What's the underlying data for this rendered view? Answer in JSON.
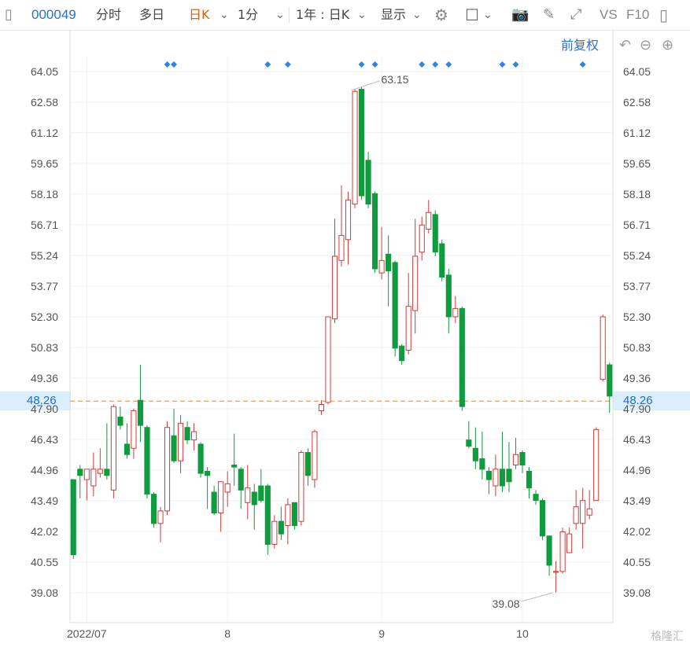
{
  "toolbar": {
    "code": "000049",
    "tabs": [
      "分时",
      "多日",
      "日K"
    ],
    "period": "1分",
    "range": "1年 : 日K",
    "display": "显示",
    "vs": "VS",
    "f10": "F10"
  },
  "adjust_label": "前复权",
  "current_price_label": "48.26",
  "watermark": "格隆汇",
  "colors": {
    "up": "#d23a3a",
    "down": "#0f9b3e",
    "accent": "#2a6fd6",
    "price_line": "#e3a06a"
  },
  "chart_data": {
    "type": "candlestick",
    "y_ticks": [
      "64.05",
      "62.58",
      "61.12",
      "59.65",
      "58.18",
      "56.71",
      "55.24",
      "53.77",
      "52.30",
      "50.83",
      "49.36",
      "47.90",
      "46.43",
      "44.96",
      "43.49",
      "42.02",
      "40.55",
      "39.08"
    ],
    "ylim": [
      38.3,
      64.6
    ],
    "x_labels": [
      {
        "label": "2022/07",
        "index": 2
      },
      {
        "label": "8",
        "index": 23
      },
      {
        "label": "9",
        "index": 46
      },
      {
        "label": "10",
        "index": 67
      }
    ],
    "current_price": 48.26,
    "annotations": [
      {
        "text": "63.15",
        "index": 41,
        "value": 63.15
      },
      {
        "text": "39.08",
        "index": 72,
        "value": 39.08
      }
    ],
    "marker_indices": [
      14,
      15,
      29,
      32,
      43,
      45,
      52,
      54,
      56,
      64,
      66,
      76
    ],
    "candles": [
      [
        44.5,
        40.9,
        44.5,
        40.7
      ],
      [
        45.0,
        44.7,
        45.2,
        43.6
      ],
      [
        44.5,
        45.0,
        45.0,
        43.5
      ],
      [
        44.2,
        45.0,
        45.8,
        43.7
      ],
      [
        44.8,
        45.0,
        46.0,
        44.6
      ],
      [
        45.0,
        44.7,
        47.2,
        44.5
      ],
      [
        44.0,
        48.0,
        48.1,
        43.6
      ],
      [
        47.5,
        47.1,
        48.0,
        46.9
      ],
      [
        46.2,
        45.7,
        47.2,
        45.5
      ],
      [
        46.0,
        47.8,
        47.9,
        45.5
      ],
      [
        48.3,
        47.1,
        50.0,
        46.3
      ],
      [
        47.0,
        43.8,
        47.1,
        43.6
      ],
      [
        43.8,
        42.4,
        43.9,
        42.2
      ],
      [
        42.4,
        43.0,
        43.2,
        41.5
      ],
      [
        43.0,
        47.0,
        47.3,
        42.8
      ],
      [
        46.6,
        45.4,
        47.9,
        45.3
      ],
      [
        45.4,
        47.2,
        47.6,
        44.8
      ],
      [
        47.0,
        46.4,
        47.3,
        46.2
      ],
      [
        46.4,
        46.8,
        47.2,
        45.9
      ],
      [
        46.2,
        44.8,
        46.3,
        44.6
      ],
      [
        44.9,
        44.7,
        45.1,
        43.1
      ],
      [
        43.9,
        42.9,
        44.2,
        42.8
      ],
      [
        42.9,
        44.4,
        44.4,
        42.0
      ],
      [
        43.9,
        44.3,
        44.9,
        43.2
      ],
      [
        45.2,
        45.1,
        46.7,
        44.2
      ],
      [
        45.0,
        44.0,
        45.1,
        43.1
      ],
      [
        43.4,
        44.1,
        45.2,
        42.6
      ],
      [
        43.9,
        43.3,
        44.3,
        42.1
      ],
      [
        44.2,
        43.5,
        45.0,
        43.4
      ],
      [
        44.2,
        41.4,
        44.3,
        40.9
      ],
      [
        41.4,
        42.5,
        42.8,
        41.2
      ],
      [
        42.5,
        41.9,
        43.2,
        41.6
      ],
      [
        42.3,
        43.3,
        43.6,
        41.4
      ],
      [
        43.4,
        42.3,
        43.4,
        42.1
      ],
      [
        42.5,
        45.8,
        45.9,
        42.3
      ],
      [
        45.8,
        44.7,
        46.0,
        44.2
      ],
      [
        44.5,
        46.8,
        46.9,
        44.1
      ],
      [
        47.8,
        48.1,
        48.3,
        47.6
      ],
      [
        48.2,
        52.3,
        52.3,
        48.1
      ],
      [
        52.2,
        55.2,
        57.0,
        52.0
      ],
      [
        55.0,
        56.2,
        58.6,
        54.7
      ],
      [
        56.0,
        57.9,
        58.3,
        54.8
      ],
      [
        57.7,
        63.1,
        63.2,
        57.5
      ],
      [
        63.2,
        58.1,
        63.3,
        57.9
      ],
      [
        59.8,
        57.7,
        60.2,
        57.5
      ],
      [
        58.2,
        54.6,
        58.3,
        54.4
      ],
      [
        54.4,
        55.0,
        56.6,
        54.1
      ],
      [
        55.3,
        54.5,
        56.2,
        52.8
      ],
      [
        54.9,
        50.8,
        55.0,
        50.4
      ],
      [
        50.9,
        50.2,
        51.0,
        50.0
      ],
      [
        50.7,
        52.8,
        54.4,
        50.5
      ],
      [
        52.6,
        55.2,
        57.0,
        51.5
      ],
      [
        55.4,
        56.7,
        57.1,
        55.0
      ],
      [
        56.5,
        57.3,
        57.9,
        56.3
      ],
      [
        57.2,
        55.4,
        57.4,
        55.2
      ],
      [
        55.8,
        54.2,
        56.0,
        54.0
      ],
      [
        54.3,
        52.3,
        54.6,
        51.5
      ],
      [
        52.3,
        52.7,
        53.3,
        52.0
      ],
      [
        52.7,
        48.0,
        52.8,
        47.8
      ],
      [
        46.4,
        46.1,
        47.3,
        46.0
      ],
      [
        46.0,
        45.4,
        47.0,
        45.0
      ],
      [
        45.5,
        45.0,
        46.8,
        44.5
      ],
      [
        44.9,
        44.5,
        45.1,
        43.8
      ],
      [
        44.2,
        45.0,
        45.7,
        43.7
      ],
      [
        45.0,
        44.2,
        46.8,
        43.9
      ],
      [
        45.0,
        44.4,
        46.3,
        43.9
      ],
      [
        45.2,
        45.7,
        46.5,
        45.0
      ],
      [
        45.8,
        45.2,
        45.9,
        44.8
      ],
      [
        44.9,
        44.1,
        45.1,
        43.6
      ],
      [
        43.8,
        43.5,
        44.0,
        43.3
      ],
      [
        43.5,
        41.8,
        43.6,
        41.6
      ],
      [
        41.8,
        40.4,
        41.8,
        39.9
      ],
      [
        40.1,
        40.1,
        40.6,
        39.1
      ],
      [
        40.1,
        42.0,
        42.2,
        40.0
      ],
      [
        41.0,
        41.9,
        42.2,
        41.0
      ],
      [
        42.4,
        43.2,
        44.0,
        42.1
      ],
      [
        42.4,
        43.5,
        44.1,
        41.2
      ],
      [
        42.8,
        43.1,
        44.0,
        42.6
      ],
      [
        43.5,
        46.9,
        47.0,
        43.5
      ],
      [
        49.3,
        52.3,
        52.4,
        49.2
      ],
      [
        50.0,
        48.5,
        50.1,
        47.7
      ]
    ]
  }
}
